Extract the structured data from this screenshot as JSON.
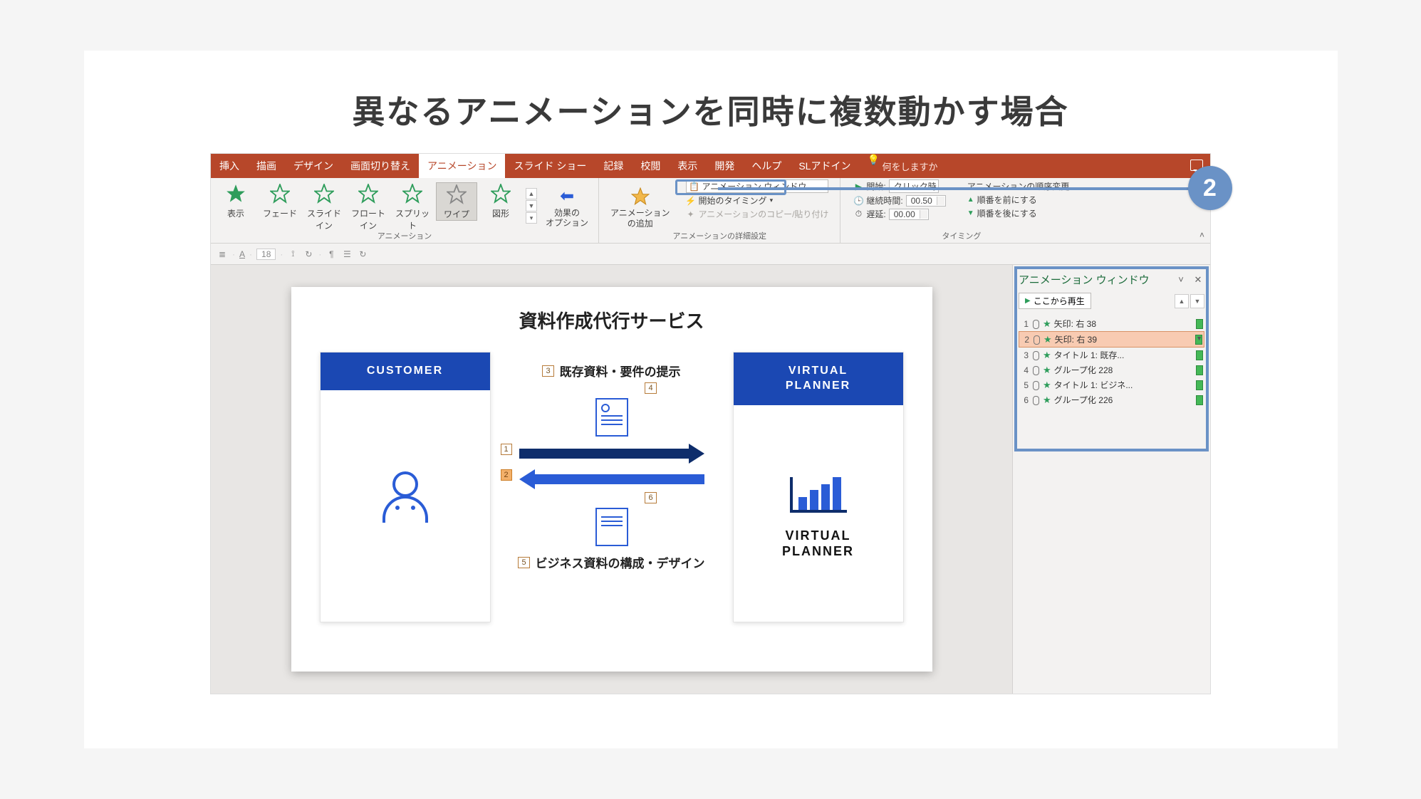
{
  "page_title": "異なるアニメーションを同時に複数動かす場合",
  "step_number": "2",
  "tabs": {
    "insert": "挿入",
    "draw": "描画",
    "design": "デザイン",
    "transitions": "画面切り替え",
    "animations": "アニメーション",
    "slideshow": "スライド ショー",
    "record": "記録",
    "review": "校閲",
    "view": "表示",
    "developer": "開発",
    "help": "ヘルプ",
    "sladdin": "SLアドイン",
    "search": "何をしますか"
  },
  "ribbon": {
    "gallery": {
      "appear": "表示",
      "fade": "フェード",
      "slidein": "スライドイン",
      "floatin": "フロートイン",
      "split": "スプリット",
      "wipe": "ワイプ",
      "shape": "図形"
    },
    "group_labels": {
      "animation": "アニメーション",
      "advanced": "アニメーションの詳細設定",
      "timing": "タイミング"
    },
    "effect_options": "効果の\nオプション",
    "add_animation": "アニメーション\nの追加",
    "anim_window_btn": "アニメーション ウィンドウ",
    "trigger": "開始のタイミング",
    "anim_painter": "アニメーションのコピー/貼り付け",
    "start_label": "開始:",
    "start_value": "クリック時",
    "duration_label": "継続時間:",
    "duration_value": "00.50",
    "delay_label": "遅延:",
    "delay_value": "00.00",
    "reorder_label": "アニメーションの順序変更",
    "move_earlier": "順番を前にする",
    "move_later": "順番を後にする"
  },
  "editbar": {
    "font_size": "18"
  },
  "slide": {
    "title": "資料作成代行サービス",
    "customer": "CUSTOMER",
    "planner_header": "VIRTUAL\nPLANNER",
    "upper_label": "既存資料・要件の提示",
    "lower_label": "ビジネス資料の構成・デザイン",
    "vp_text1": "VIRTUAL",
    "vp_text2": "PLANNER",
    "tags": {
      "t1": "1",
      "t2": "2",
      "t3": "3",
      "t4": "4",
      "t5": "5",
      "t6": "6"
    }
  },
  "pane": {
    "title": "アニメーション ウィンドウ",
    "play_from_here": "ここから再生",
    "items": [
      {
        "n": "1",
        "label": "矢印: 右 38"
      },
      {
        "n": "2",
        "label": "矢印: 右 39"
      },
      {
        "n": "3",
        "label": "タイトル 1: 既存..."
      },
      {
        "n": "4",
        "label": "グループ化 228"
      },
      {
        "n": "5",
        "label": "タイトル 1: ビジネ..."
      },
      {
        "n": "6",
        "label": "グループ化 226"
      }
    ]
  }
}
